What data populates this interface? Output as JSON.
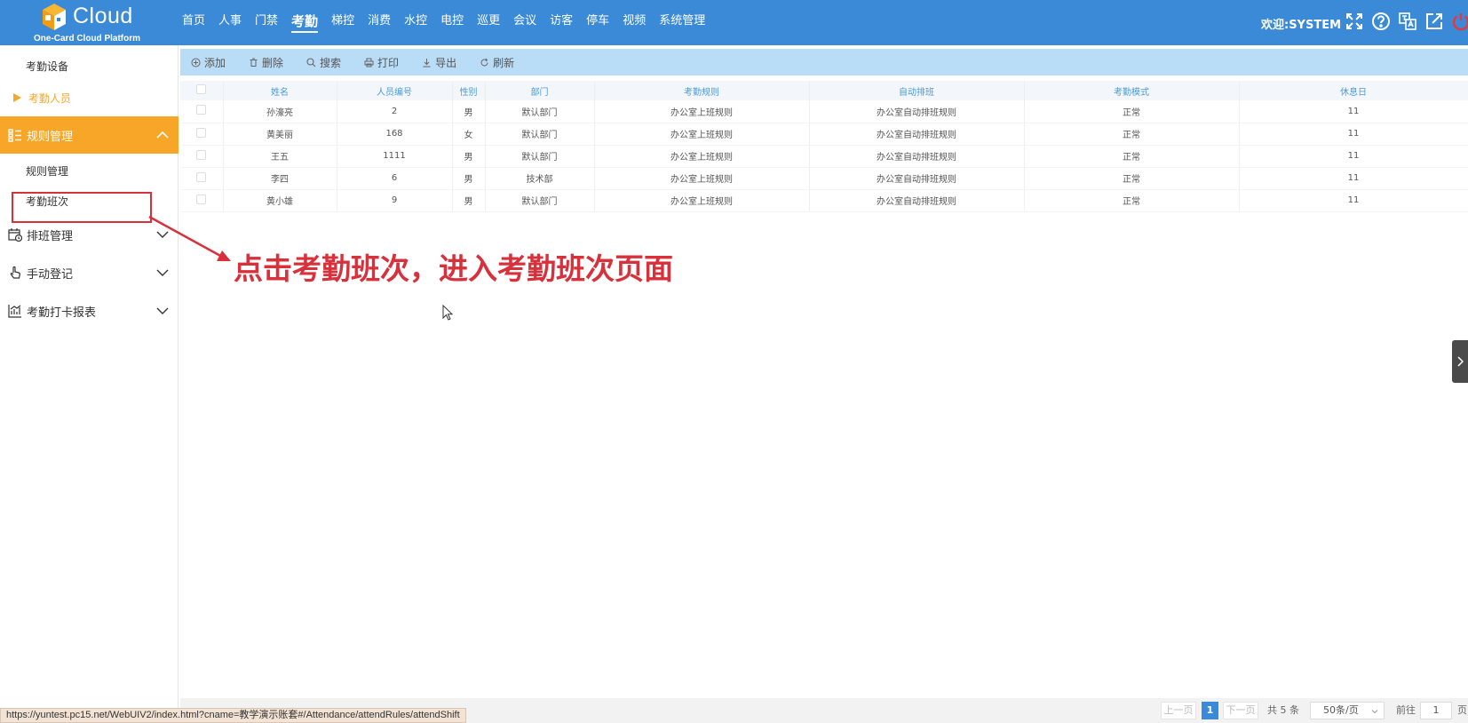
{
  "app": {
    "brand": "Cloud",
    "subtitle": "One-Card Cloud Platform"
  },
  "topnav": [
    {
      "label": "首页"
    },
    {
      "label": "人事"
    },
    {
      "label": "门禁"
    },
    {
      "label": "考勤",
      "active": true
    },
    {
      "label": "梯控"
    },
    {
      "label": "消费"
    },
    {
      "label": "水控"
    },
    {
      "label": "电控"
    },
    {
      "label": "巡更"
    },
    {
      "label": "会议"
    },
    {
      "label": "访客"
    },
    {
      "label": "停车"
    },
    {
      "label": "视频"
    },
    {
      "label": "系统管理"
    }
  ],
  "header": {
    "welcome": "欢迎:SYSTEM",
    "icons": [
      "fullscreen-icon",
      "help-icon",
      "language-icon",
      "external-link-icon",
      "power-icon"
    ]
  },
  "sidebar": {
    "items": [
      {
        "label": "考勤设备"
      },
      {
        "label": "考勤人员"
      },
      {
        "label": "规则管理"
      },
      {
        "label": "规则管理"
      },
      {
        "label": "考勤班次"
      },
      {
        "label": "排班管理"
      },
      {
        "label": "手动登记"
      },
      {
        "label": "考勤打卡报表"
      }
    ]
  },
  "toolbar": {
    "add": "添加",
    "delete": "删除",
    "search": "搜索",
    "print": "打印",
    "export": "导出",
    "refresh": "刷新"
  },
  "table": {
    "columns": [
      "姓名",
      "人员编号",
      "性别",
      "部门",
      "考勤规则",
      "自动排班",
      "考勤模式",
      "休息日"
    ],
    "rows": [
      [
        "孙濠亮",
        "2",
        "男",
        "默认部门",
        "办公室上班规则",
        "办公室自动排班规则",
        "正常",
        "11"
      ],
      [
        "黄美丽",
        "168",
        "女",
        "默认部门",
        "办公室上班规则",
        "办公室自动排班规则",
        "正常",
        "11"
      ],
      [
        "王五",
        "1111",
        "男",
        "默认部门",
        "办公室上班规则",
        "办公室自动排班规则",
        "正常",
        "11"
      ],
      [
        "李四",
        "6",
        "男",
        "技术部",
        "办公室上班规则",
        "办公室自动排班规则",
        "正常",
        "11"
      ],
      [
        "黄小雄",
        "9",
        "男",
        "默认部门",
        "办公室上班规则",
        "办公室自动排班规则",
        "正常",
        "11"
      ]
    ]
  },
  "annotation": {
    "text": "点击考勤班次，进入考勤班次页面",
    "color": "#d8313b"
  },
  "pager": {
    "prev": "上一页",
    "current": "1",
    "next": "下一页",
    "total": "共 5 条",
    "page_size": "50条/页",
    "goto_label": "前往",
    "goto_value": "1",
    "page_suffix": "页"
  },
  "status_url": "https://yuntest.pc15.net/WebUIV2/index.html?cname=教学演示账套#/Attendance/attendRules/attendShift",
  "colors": {
    "header": "#3a8ad8",
    "accent": "#f7a627",
    "toolbar": "#b9dcf7",
    "annotation": "#d8313b"
  }
}
